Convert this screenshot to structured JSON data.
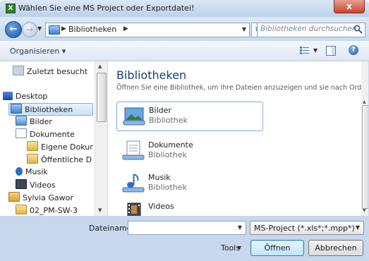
{
  "window": {
    "title": "Wählen Sie eine MS Project oder Exportdatei!",
    "app_icon_glyph": "X",
    "close_glyph": "x"
  },
  "nav": {
    "back_glyph": "←",
    "forward_glyph": "→",
    "breadcrumb": "Bibliotheken",
    "search_placeholder": "Bibliotheken durchsuchen"
  },
  "toolbar": {
    "organize_label": "Organisieren ▾",
    "help_glyph": "?"
  },
  "sidebar": {
    "items": [
      {
        "label": "Zuletzt besucht",
        "icon": "recent-places-icon"
      },
      {
        "label": "Desktop",
        "icon": "desktop-icon"
      },
      {
        "label": "Bibliotheken",
        "icon": "libraries-icon",
        "selected": true
      },
      {
        "label": "Bilder",
        "icon": "pictures-icon"
      },
      {
        "label": "Dokumente",
        "icon": "documents-icon"
      },
      {
        "label": "Eigene Dokur",
        "icon": "folder-icon"
      },
      {
        "label": "Öffentliche D",
        "icon": "folder-icon"
      },
      {
        "label": "Musik",
        "icon": "music-icon"
      },
      {
        "label": "Videos",
        "icon": "videos-icon"
      },
      {
        "label": "Sylvia Gawor",
        "icon": "user-folder-icon"
      },
      {
        "label": "02_PM-SW-3",
        "icon": "folder-icon"
      }
    ]
  },
  "content": {
    "title": "Bibliotheken",
    "subtitle": "Öffnen Sie eine Bibliothek, um Ihre Dateien anzuzeigen und sie nach Ordne...",
    "libraries": [
      {
        "name": "Bilder",
        "type": "Bibliothek",
        "icon": "pictures-library-icon"
      },
      {
        "name": "Dokumente",
        "type": "Bibliothek",
        "icon": "documents-library-icon"
      },
      {
        "name": "Musik",
        "type": "Bibliothek",
        "icon": "music-library-icon"
      },
      {
        "name": "Videos",
        "type": "",
        "icon": "videos-library-icon"
      }
    ]
  },
  "bottom": {
    "filename_label": "Dateiname:",
    "filename_value": "",
    "filter_value": "MS-Project (*.xls*;*.mpp*)",
    "tools_label": "Tools",
    "open_label": "Öffnen",
    "cancel_label": "Abbrechen"
  },
  "colors": {
    "frame": "#c7d8ed",
    "title_text": "#1a3f78",
    "selection_border": "#84acdd"
  }
}
